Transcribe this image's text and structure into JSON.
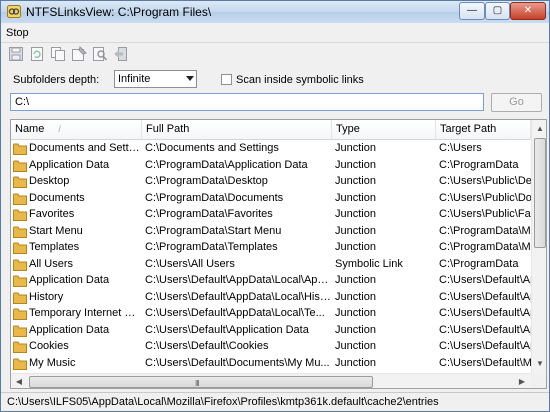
{
  "window": {
    "title": "NTFSLinksView:  C:\\Program Files\\",
    "minimize": "—",
    "maximize": "▢",
    "close": "✕"
  },
  "menu": {
    "stop": "Stop"
  },
  "toolbar": {
    "icons": [
      "save-icon",
      "refresh-icon",
      "copy-icon",
      "properties-icon",
      "find-icon",
      "exit-icon"
    ]
  },
  "options": {
    "subfolders_label": "Subfolders depth:",
    "subfolders_value": "Infinite",
    "scan_symbolic_label": "Scan inside symbolic links",
    "scan_symbolic_checked": false
  },
  "path": {
    "value": "C:\\",
    "go_label": "Go"
  },
  "table": {
    "columns": [
      "Name",
      "Full Path",
      "Type",
      "Target Path"
    ],
    "sort_indicator": "/",
    "rows": [
      {
        "name": "Documents and Settin...",
        "full": "C:\\Documents and Settings",
        "type": "Junction",
        "target": "C:\\Users"
      },
      {
        "name": "Application Data",
        "full": "C:\\ProgramData\\Application Data",
        "type": "Junction",
        "target": "C:\\ProgramData"
      },
      {
        "name": "Desktop",
        "full": "C:\\ProgramData\\Desktop",
        "type": "Junction",
        "target": "C:\\Users\\Public\\Desk"
      },
      {
        "name": "Documents",
        "full": "C:\\ProgramData\\Documents",
        "type": "Junction",
        "target": "C:\\Users\\Public\\Doc"
      },
      {
        "name": "Favorites",
        "full": "C:\\ProgramData\\Favorites",
        "type": "Junction",
        "target": "C:\\Users\\Public\\Favo"
      },
      {
        "name": "Start Menu",
        "full": "C:\\ProgramData\\Start Menu",
        "type": "Junction",
        "target": "C:\\ProgramData\\Mic"
      },
      {
        "name": "Templates",
        "full": "C:\\ProgramData\\Templates",
        "type": "Junction",
        "target": "C:\\ProgramData\\Mic"
      },
      {
        "name": "All Users",
        "full": "C:\\Users\\All Users",
        "type": "Symbolic Link",
        "target": "C:\\ProgramData"
      },
      {
        "name": "Application Data",
        "full": "C:\\Users\\Default\\AppData\\Local\\App...",
        "type": "Junction",
        "target": "C:\\Users\\Default\\App"
      },
      {
        "name": "History",
        "full": "C:\\Users\\Default\\AppData\\Local\\Hist...",
        "type": "Junction",
        "target": "C:\\Users\\Default\\App"
      },
      {
        "name": "Temporary Internet Fil...",
        "full": "C:\\Users\\Default\\AppData\\Local\\Te...",
        "type": "Junction",
        "target": "C:\\Users\\Default\\App"
      },
      {
        "name": "Application Data",
        "full": "C:\\Users\\Default\\Application Data",
        "type": "Junction",
        "target": "C:\\Users\\Default\\App"
      },
      {
        "name": "Cookies",
        "full": "C:\\Users\\Default\\Cookies",
        "type": "Junction",
        "target": "C:\\Users\\Default\\App"
      },
      {
        "name": "My Music",
        "full": "C:\\Users\\Default\\Documents\\My Mu...",
        "type": "Junction",
        "target": "C:\\Users\\Default\\Mu"
      }
    ]
  },
  "scrollbar": {
    "grip": "III",
    "up": "▲",
    "down": "▼",
    "left": "◀",
    "right": "▶"
  },
  "status": {
    "text": "C:\\Users\\ILFS05\\AppData\\Local\\Mozilla\\Firefox\\Profiles\\kmtp361k.default\\cache2\\entries"
  },
  "colors": {
    "folder": "#e8b84a",
    "titlebar": "#c4d8ee",
    "close_button": "#c7412b"
  }
}
